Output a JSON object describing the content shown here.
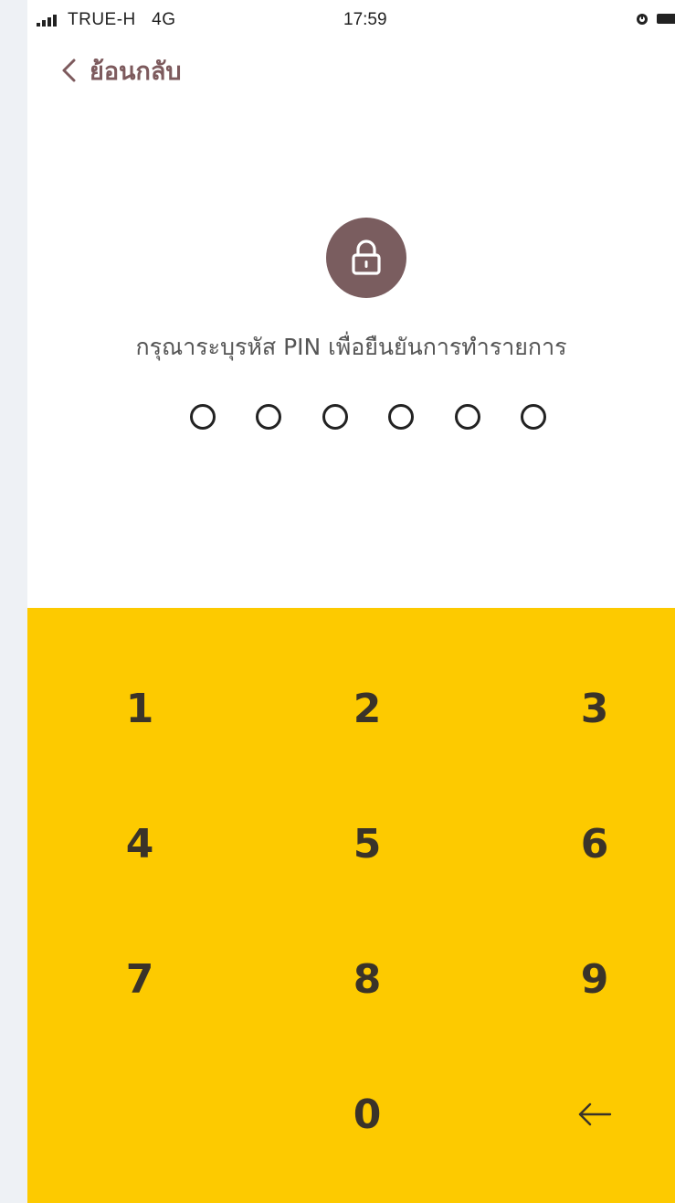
{
  "status_bar": {
    "carrier": "TRUE-H",
    "network": "4G",
    "time": "17:59"
  },
  "nav": {
    "back_label": "ย้อนกลับ"
  },
  "lock": {
    "icon": "lock-icon",
    "badge_color": "#7a5d5f"
  },
  "prompt": "กรุณาระบุรหัส PIN เพื่อยืนยันการทำรายการ",
  "pin": {
    "length": 6,
    "filled": 0
  },
  "keypad": {
    "background_color": "#fdca00",
    "keys": {
      "k1": "1",
      "k2": "2",
      "k3": "3",
      "k4": "4",
      "k5": "5",
      "k6": "6",
      "k7": "7",
      "k8": "8",
      "k9": "9",
      "k0": "0"
    },
    "backspace_icon": "backspace-arrow-icon"
  }
}
